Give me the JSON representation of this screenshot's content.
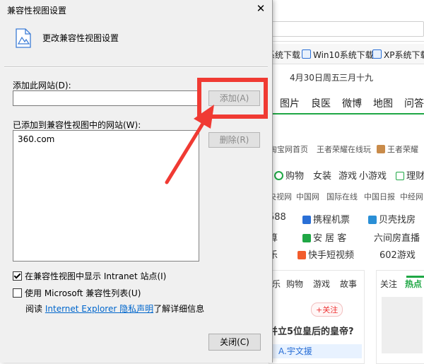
{
  "background": {
    "favorites": [
      "系统下载",
      "Win10系统下载",
      "XP系统下载"
    ],
    "date": "4月30日周五",
    "lunar": "三月十九",
    "nav": [
      "图片",
      "良医",
      "微博",
      "地图",
      "问答"
    ],
    "row1": [
      "淘宝网首页",
      "王者荣耀在线玩",
      "王者荣耀"
    ],
    "row2": [
      "购物",
      "女装",
      "游戏",
      "小游戏",
      "理财"
    ],
    "row3": [
      "央视网",
      "中国网",
      "国际在线",
      "中国日报",
      "中经网"
    ],
    "row4": [
      "588",
      "携程机票",
      "贝壳找房"
    ],
    "row5": [
      "算",
      "安 居 客",
      "六间房直播"
    ],
    "row6": [
      "乐",
      "快手短视频",
      "602游戏"
    ],
    "tabs": [
      "乐",
      "购物",
      "游戏",
      "故事"
    ],
    "right_tabs": [
      "关注",
      "热点"
    ],
    "follow": "+关注",
    "headline": "并立5位皇后的皇帝?",
    "author": "A.宇文援"
  },
  "dialog": {
    "title": "兼容性视图设置",
    "close_glyph": "✕",
    "heading": "更改兼容性视图设置",
    "add_site_label": "添加此网站(D):",
    "add_site_value": "",
    "add_button": "添加(A)",
    "list_label": "已添加到兼容性视图中的网站(W):",
    "sites": [
      "360.com"
    ],
    "remove_button": "删除(R)",
    "check_intranet": "在兼容性视图中显示 Intranet 站点(I)",
    "check_intranet_checked": true,
    "check_mslist": "使用 Microsoft 兼容性列表(U)",
    "check_mslist_checked": false,
    "info_prefix": "阅读",
    "info_link": "Internet Explorer 隐私声明",
    "info_suffix": "了解详细信息",
    "close_button": "关闭(C)"
  },
  "annotation": {
    "color": "#f03a33"
  }
}
